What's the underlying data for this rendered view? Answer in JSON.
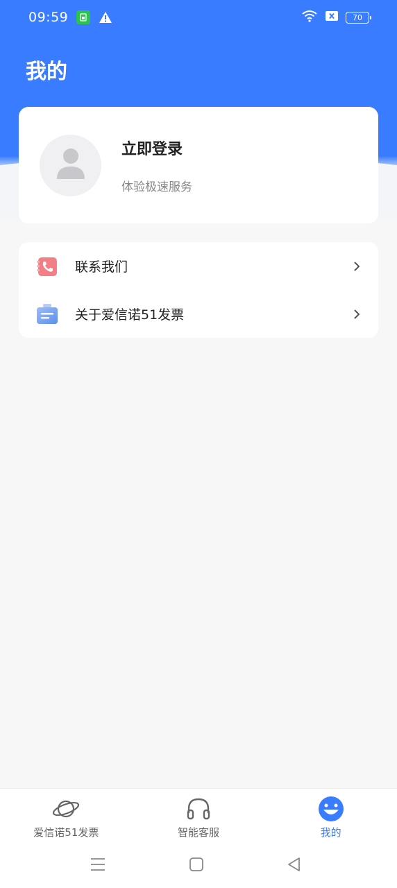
{
  "status_bar": {
    "time": "09:59",
    "battery": "70",
    "icons": [
      "sim-icon",
      "warning-icon",
      "wifi-icon",
      "no-sim-icon",
      "battery-icon"
    ]
  },
  "page": {
    "title": "我的"
  },
  "profile": {
    "login_label": "立即登录",
    "subtitle": "体验极速服务",
    "avatar_icon": "person-icon"
  },
  "menu": {
    "items": [
      {
        "label": "联系我们",
        "icon": "phone-book-icon"
      },
      {
        "label": "关于爱信诺51发票",
        "icon": "briefcase-icon"
      }
    ]
  },
  "tabs": [
    {
      "label": "爱信诺51发票",
      "icon": "planet-icon",
      "active": false
    },
    {
      "label": "智能客服",
      "icon": "headphones-icon",
      "active": false
    },
    {
      "label": "我的",
      "icon": "smiley-icon",
      "active": true
    }
  ],
  "colors": {
    "primary": "#3a7cff",
    "background": "#f7f7f7",
    "card": "#ffffff",
    "muted_text": "#888888"
  }
}
